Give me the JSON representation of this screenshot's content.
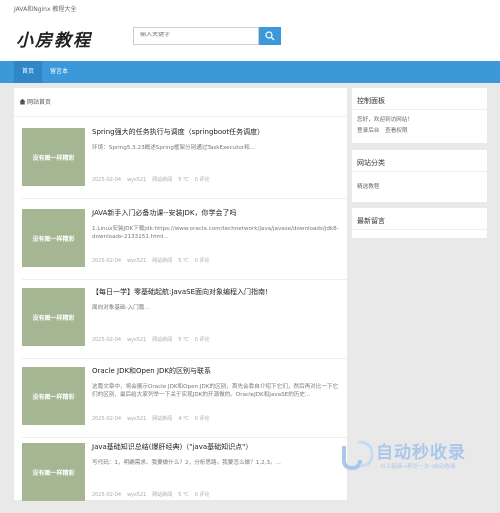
{
  "topbar": {
    "text": "JAVA和Nginx 教程大全"
  },
  "header": {
    "logo_text": "小房教程"
  },
  "search": {
    "placeholder": "输入关键字"
  },
  "nav": {
    "items": [
      "首页",
      "留言本"
    ]
  },
  "breadcrumb": {
    "label": "网站首页"
  },
  "thumb_text": "没有图一样精彩",
  "articles": [
    {
      "title": "Spring强大的任务执行与调度（springboot任务调度）",
      "excerpt": "环境：Spring5.3.23概述Spring框架分别通过TaskExecutor和...",
      "date": "2025-02-04",
      "author": "wys521",
      "category": "网站新闻",
      "temp": "5 ℃",
      "comments": "0 评论"
    },
    {
      "title": "JAVA新手入门必备功课--安装JDK，你学会了吗",
      "excerpt": "1.Linux安装JDK下载jdk:https://www.oracle.com/technetwork/java/javase/downloads/jdk8-downloads-2133151.html...",
      "date": "2025-02-04",
      "author": "wys521",
      "category": "网站新闻",
      "temp": "5 ℃",
      "comments": "0 评论"
    },
    {
      "title": "【每日一学】零基础起航:JavaSE面向对象编程入门指南!",
      "excerpt": "面向对象基础-入门篇...",
      "date": "2025-02-04",
      "author": "wys521",
      "category": "网站新闻",
      "temp": "5 ℃",
      "comments": "0 评论"
    },
    {
      "title": "Oracle JDK和Open JDK的区别与联系",
      "excerpt": "这篇文章中，将会展示Oracle JDK和Open JDK的区别，首先会靠自介绍下它们，然后再对比一下它们的区别，最后给大家列举一下关于实现JDK的开源做的。OracleJDK和JavaSE的历史...",
      "date": "2025-02-04",
      "author": "wys521",
      "category": "网站新闻",
      "temp": "4 ℃",
      "comments": "0 评论"
    },
    {
      "title": "Java基础知识总结(爆肝经典)（\"java基础知识点\"）",
      "excerpt": "写代码：1，明确需求。我要做什么？2，分析思路。我要怎么做？1,2,3。...",
      "date": "2025-02-04",
      "author": "wys521",
      "category": "网站新闻",
      "temp": "5 ℃",
      "comments": "0 评论"
    }
  ],
  "sidebar": {
    "control": {
      "title": "控制面板",
      "greeting": "您好，欢迎到访网站！",
      "login": "登录后台",
      "view_rights": "查看权限"
    },
    "categories": {
      "title": "网站分类",
      "items": [
        "精选教程"
      ]
    },
    "comments": {
      "title": "最新留言"
    }
  },
  "watermark": {
    "title": "自动秒收录",
    "subtitle": "以上链接→来访一次→自动收录"
  },
  "colors": {
    "accent": "#3b99d9",
    "thumb": "#a4b792"
  }
}
